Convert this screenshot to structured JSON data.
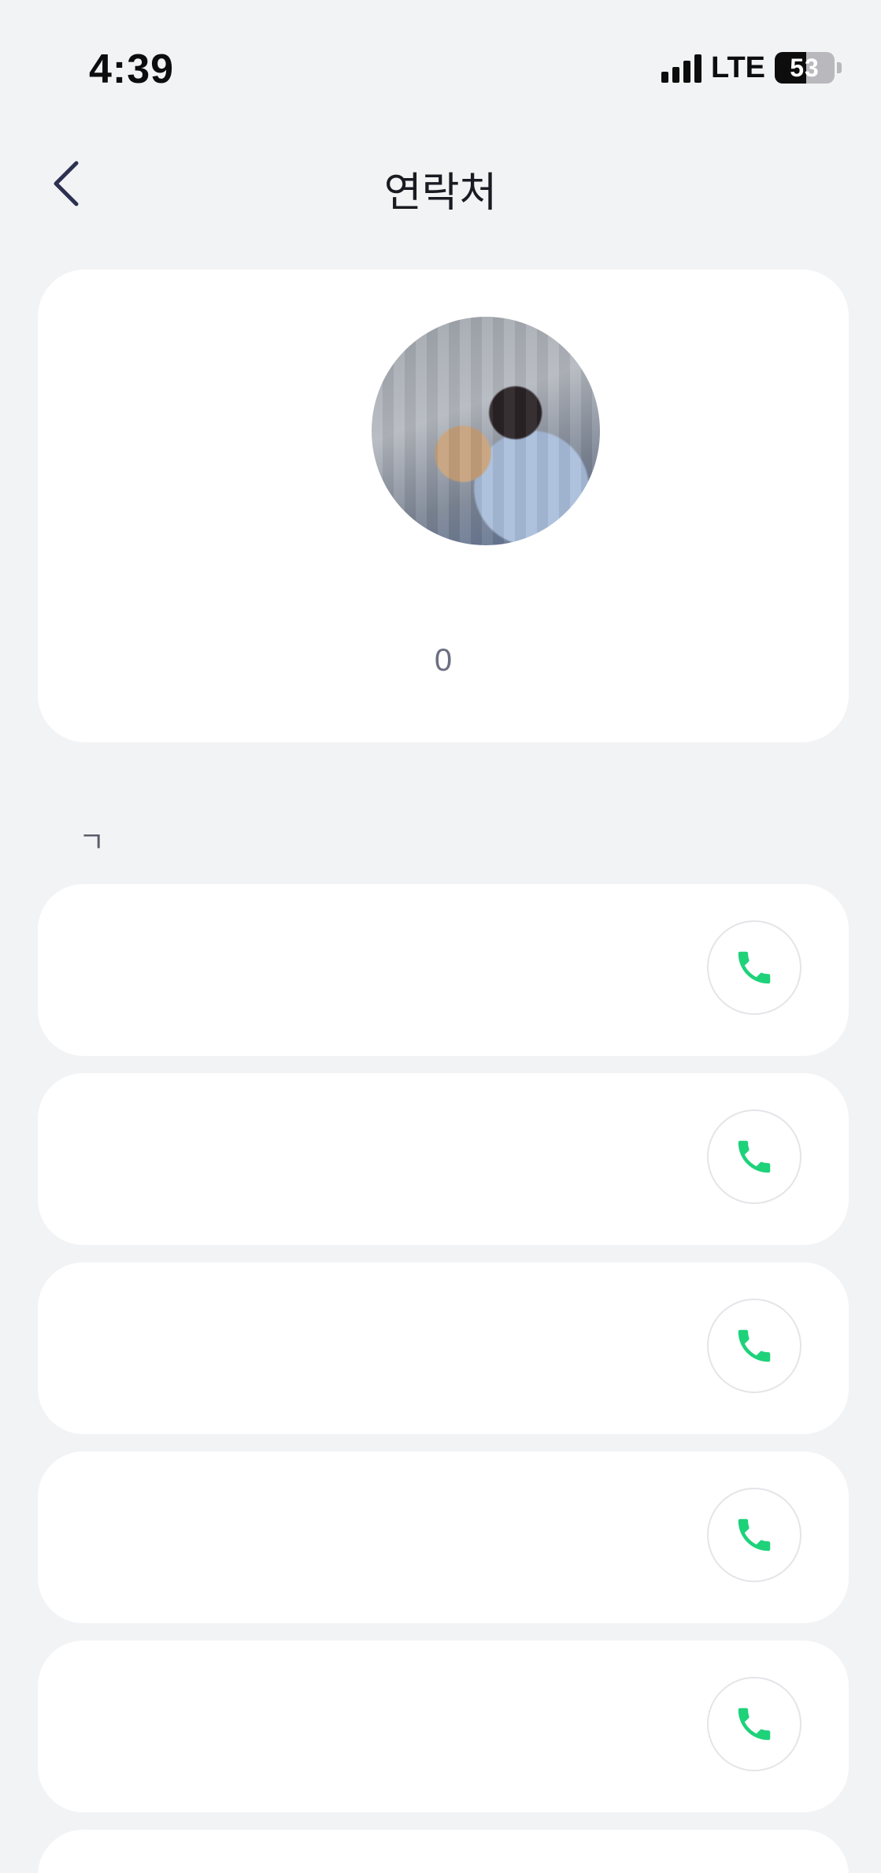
{
  "status_bar": {
    "time": "4:39",
    "network": "LTE",
    "battery": "53",
    "battery_level": 0.53
  },
  "nav": {
    "title": "연락처",
    "back_icon": "chevron-left-icon"
  },
  "profile": {
    "name": "",
    "phone": "0"
  },
  "section": {
    "label": "ㄱ"
  },
  "contacts": [
    {
      "name": "",
      "call_icon": "phone-icon"
    },
    {
      "name": "",
      "call_icon": "phone-icon"
    },
    {
      "name": "",
      "call_icon": "phone-icon"
    },
    {
      "name": "",
      "call_icon": "phone-icon"
    },
    {
      "name": "",
      "call_icon": "phone-icon"
    }
  ],
  "colors": {
    "background": "#f2f3f5",
    "card": "#ffffff",
    "call_icon": "#1ed27a",
    "name_text": "#30345a"
  }
}
